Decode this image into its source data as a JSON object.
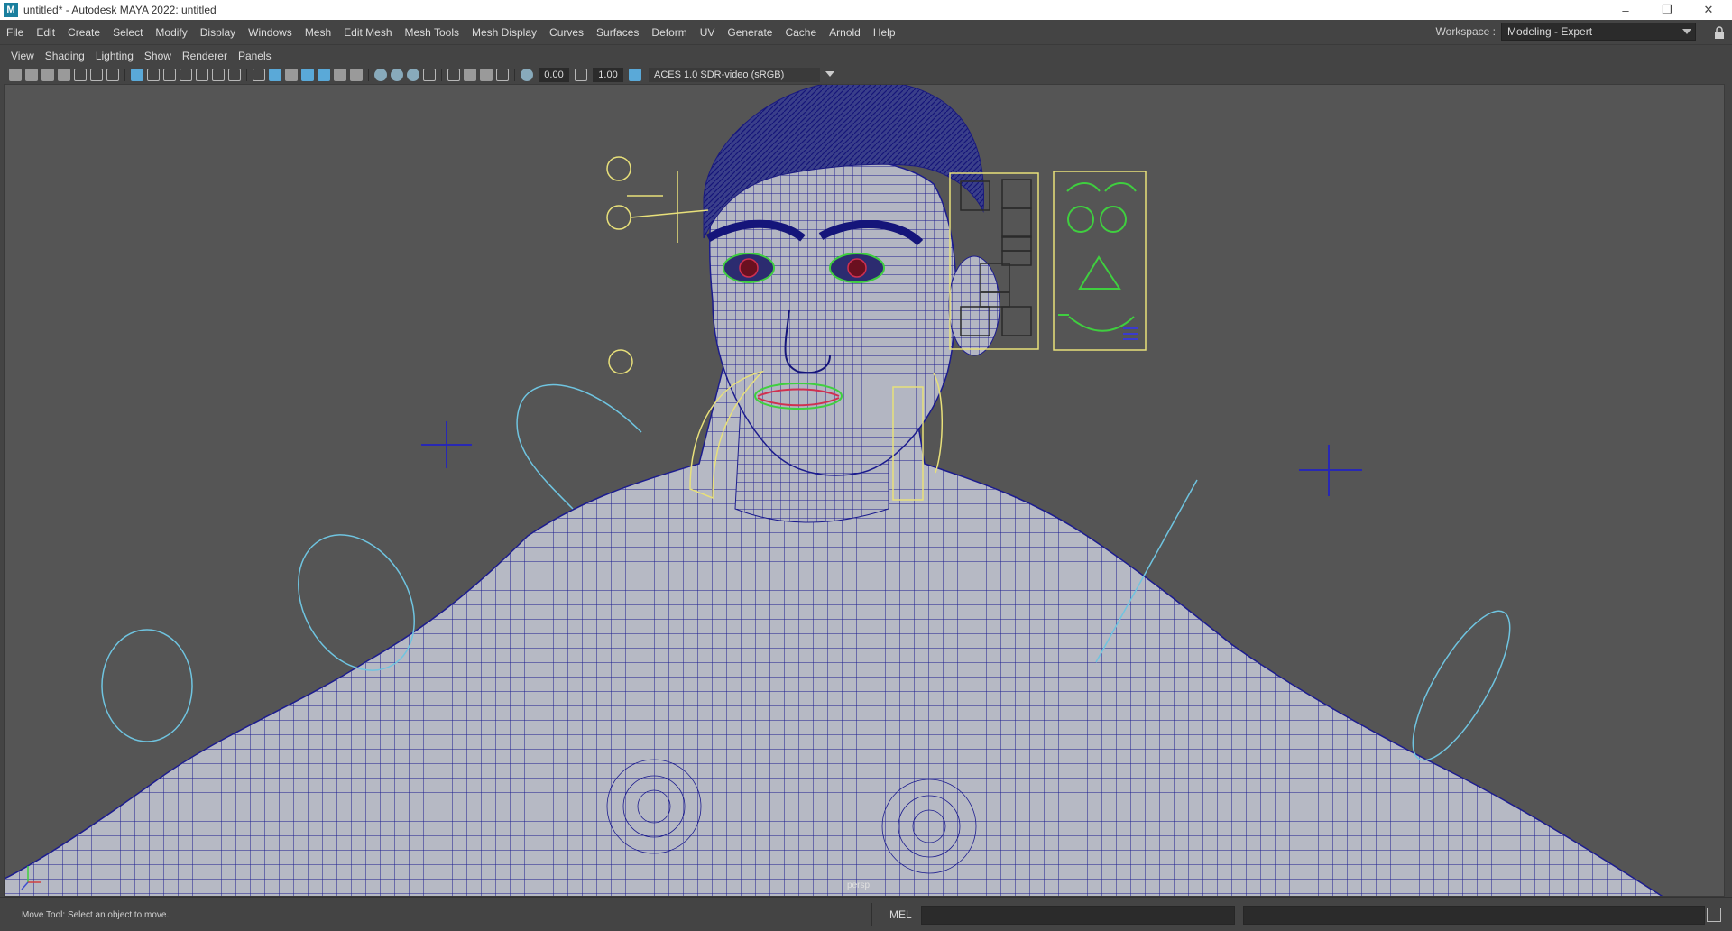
{
  "window": {
    "title": "untitled* - Autodesk MAYA 2022: untitled",
    "app_icon_letter": "M",
    "minimize": "–",
    "restore": "❐",
    "close": "✕"
  },
  "menubar": {
    "items": [
      "File",
      "Edit",
      "Create",
      "Select",
      "Modify",
      "Display",
      "Windows",
      "Mesh",
      "Edit Mesh",
      "Mesh Tools",
      "Mesh Display",
      "Curves",
      "Surfaces",
      "Deform",
      "UV",
      "Generate",
      "Cache",
      "Arnold",
      "Help"
    ],
    "workspace_label": "Workspace :",
    "workspace_value": "Modeling - Expert"
  },
  "panel_menu": {
    "items": [
      "View",
      "Shading",
      "Lighting",
      "Show",
      "Renderer",
      "Panels"
    ]
  },
  "toolbar": {
    "exposure": "0.00",
    "gamma": "1.00",
    "color_space": "ACES 1.0 SDR-video (sRGB)"
  },
  "viewport": {
    "camera": "persp",
    "wireframe_color": "#1a1a8c",
    "mesh_color": "#b4b8c4",
    "control_yellow": "#e8e07a",
    "control_cyan": "#6fc4e0",
    "control_green": "#3fcf3f",
    "icons": [
      "move-icon",
      "camera-icon"
    ]
  },
  "statusbar": {
    "help_text": "Move Tool: Select an object to move.",
    "mel_label": "MEL"
  }
}
